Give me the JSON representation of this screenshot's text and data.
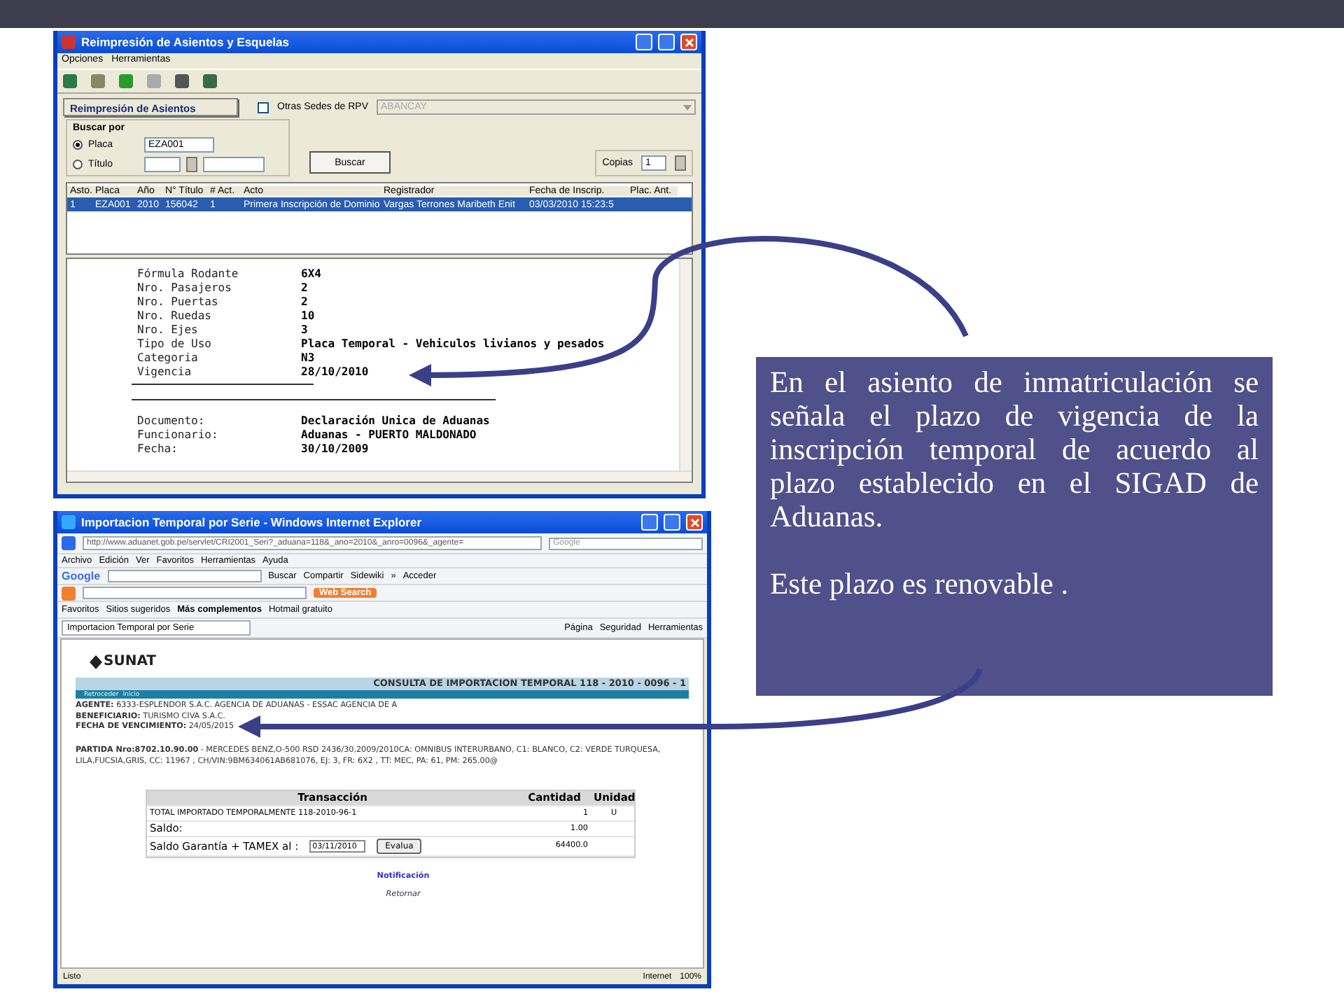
{
  "win1": {
    "title": "Reimpresión de Asientos y Esquelas",
    "menu": [
      "Opciones",
      "Herramientas"
    ],
    "tab": "Reimpresión de Asientos",
    "other_sedes": {
      "label": "Otras Sedes de RPV",
      "checked": false
    },
    "sede_select": {
      "value": "ABANCAY",
      "disabled": true
    },
    "search_group": {
      "title": "Buscar por",
      "options": [
        {
          "label": "Placa",
          "selected": true,
          "value": "EZA001"
        },
        {
          "label": "Título",
          "selected": false
        }
      ]
    },
    "search_button": "Buscar",
    "copies": {
      "label": "Copias",
      "value": "1"
    },
    "table": {
      "columns": [
        "Asto.",
        "Placa",
        "Año",
        "N° Título",
        "# Act.",
        "Acto",
        "Registrador",
        "Fecha de Inscrip.",
        "Plac. Ant."
      ],
      "rows": [
        {
          "selected": true,
          "cells": [
            "1",
            "EZA001",
            "2010",
            "156042",
            "1",
            "Primera Inscripción de Dominio",
            "Vargas Terrones Maribeth Enit",
            "03/03/2010 15:23:5",
            null
          ]
        }
      ]
    },
    "document": {
      "fields": [
        [
          "Fórmula Rodante",
          "6X4"
        ],
        [
          "Nro. Pasajeros",
          "2"
        ],
        [
          "Nro. Puertas",
          "2"
        ],
        [
          "Nro. Ruedas",
          "10"
        ],
        [
          "Nro. Ejes",
          "3"
        ],
        [
          "Tipo de Uso",
          "Placa Temporal - Vehiculos livianos y pesados"
        ],
        [
          "Categoria",
          "N3"
        ],
        [
          "Vigencia",
          "28/10/2010"
        ]
      ],
      "footer": [
        [
          "Documento:",
          "Declaración Unica de Aduanas"
        ],
        [
          "Funcionario:",
          "Aduanas - PUERTO MALDONADO"
        ],
        [
          "Fecha:",
          "30/10/2009"
        ]
      ]
    }
  },
  "win2": {
    "title": "Importacion Temporal por Serie - Windows Internet Explorer",
    "address": "http://www.aduanet.gob.pe/servlet/CRI2001_Seri?_aduana=118&_ano=2010&_anro=0096&_agente=",
    "search_placeholder": "Google",
    "menu": [
      "Archivo",
      "Edición",
      "Ver",
      "Favoritos",
      "Herramientas",
      "Ayuda"
    ],
    "google_bar": {
      "brand": "Google",
      "items": [
        "Buscar",
        "Compartir",
        "Sidewiki",
        "»",
        "Acceder"
      ]
    },
    "web_search": "Web Search",
    "favorites": [
      "Favoritos",
      "Sitios sugeridos",
      "Más complementos",
      "Hotmail gratuito"
    ],
    "tab": "Importacion Temporal por Serie",
    "command_bar": [
      "Página",
      "Seguridad",
      "Herramientas"
    ],
    "page": {
      "logo": "SUNAT",
      "heading": "CONSULTA DE IMPORTACION TEMPORAL 118 - 2010 - 0096 - 1",
      "nav": [
        "Retroceder",
        "Inicio"
      ],
      "info": [
        "**AGENTE:** 6333-ESPLENDOR S.A.C. AGENCIA DE ADUANAS - ESSAC AGENCIA DE A",
        "**BENEFICIARIO:** TURISMO CIVA S.A.C.",
        "**FECHA DE VENCIMIENTO:** 24/05/2015"
      ],
      "partida": "**PARTIDA Nro:8702.10.90.00** - MERCEDES BENZ,O-500 RSD 2436/30,2009/2010CA: OMNIBUS INTERURBANO, C1: BLANCO, C2: VERDE TURQUESA, LILA,FUCSIA,GRIS, CC: 11967 , CH/VIN:9BM634061AB681076, EJ: 3, FR: 6X2 , TT: MEC, PA: 61, PM: 265.00@",
      "table": {
        "columns": [
          "Transacción",
          "Cantidad",
          "Unidad"
        ],
        "rows": [
          {
            "kind": "text",
            "cells": [
              "TOTAL IMPORTADO TEMPORALMENTE   118-2010-96-1",
              "1",
              "U"
            ]
          },
          {
            "kind": "text",
            "cells": [
              "Saldo:",
              "1.00",
              null
            ]
          },
          {
            "kind": "form",
            "label": "Saldo Garantía + TAMEX al :",
            "date": "03/11/2010",
            "button": "Evalua",
            "cells": [
              null,
              "64400.0",
              null
            ]
          }
        ]
      },
      "links": [
        "Notificación",
        "Retornar"
      ]
    },
    "status": {
      "text": "Listo",
      "zone": "Internet",
      "zoom": "100%"
    }
  },
  "note": {
    "paragraphs": [
      "En el asiento de inmatriculación se señala el plazo de vigencia de la inscripción temporal de acuerdo al plazo establecido en el SIGAD de Aduanas.",
      "Este plazo es renovable ."
    ]
  }
}
